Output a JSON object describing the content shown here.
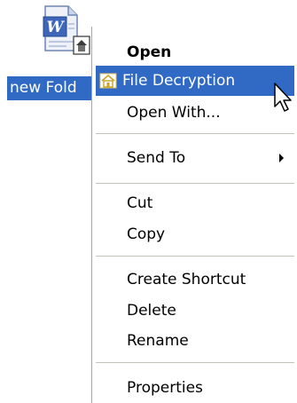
{
  "file": {
    "label": "new Fold",
    "icon": "word-document-icon"
  },
  "menu": {
    "items": [
      {
        "label": "Open",
        "bold": true
      },
      {
        "label": "File Decryption",
        "icon": "decryption-icon",
        "highlighted": true
      },
      {
        "label": "Open With..."
      },
      {
        "label": "Send To",
        "submenu": true
      },
      {
        "label": "Cut"
      },
      {
        "label": "Copy"
      },
      {
        "label": "Create Shortcut"
      },
      {
        "label": "Delete"
      },
      {
        "label": "Rename"
      },
      {
        "label": "Properties"
      }
    ]
  },
  "colors": {
    "selection": "#316ac5",
    "menu_background": "#ffffff",
    "separator": "#c5c2b8"
  },
  "cursor": "arrow-cursor-icon"
}
